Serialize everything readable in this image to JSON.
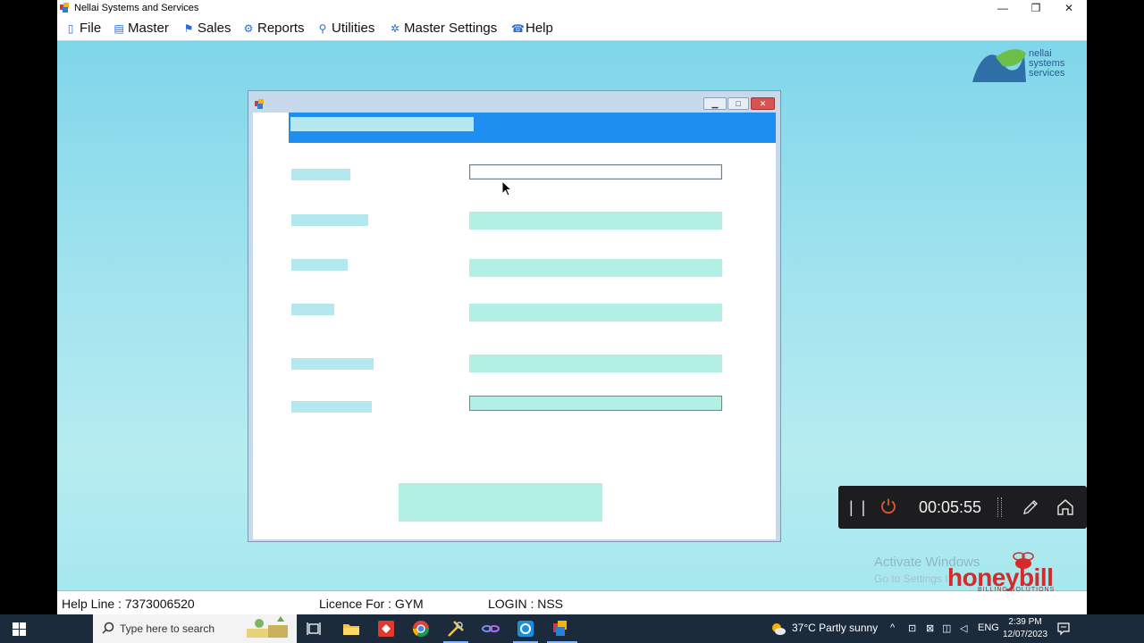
{
  "window": {
    "title": "Nellai Systems and Services",
    "minimize_glyph": "—",
    "restore_glyph": "❐",
    "close_glyph": "✕"
  },
  "menu": {
    "items": [
      {
        "label": "File",
        "icon": "file-icon"
      },
      {
        "label": "Master",
        "icon": "master-icon"
      },
      {
        "label": "Sales",
        "icon": "sales-icon"
      },
      {
        "label": "Reports",
        "icon": "reports-icon"
      },
      {
        "label": "Utilities",
        "icon": "utilities-icon"
      },
      {
        "label": "Master Settings",
        "icon": "settings-icon"
      },
      {
        "label": "Help",
        "icon": "help-icon"
      }
    ]
  },
  "logo": {
    "line1": "nellai",
    "line2": "systems",
    "line3": "services"
  },
  "dialog": {
    "minimize_glyph": "▁",
    "maximize_glyph": "□",
    "close_glyph": "✕"
  },
  "recorder": {
    "elapsed": "00:05:55"
  },
  "watermark": {
    "activate_title": "Activate Windows",
    "activate_sub": "Go to Settings t"
  },
  "brand": {
    "name": "honeybill",
    "tagline": "BILLING SOLUTIONS"
  },
  "status": {
    "helpline": "Help Line : 7373006520",
    "licence": "Licence For :  GYM",
    "login": "LOGIN : NSS"
  },
  "taskbar": {
    "search_placeholder": "Type here to search",
    "weather": "37°C  Partly sunny",
    "language": "ENG",
    "time": "2:39 PM",
    "date": "12/07/2023"
  },
  "colors": {
    "desktop": "#8fdcea",
    "accent_bar": "#1e8ff0",
    "placeholder_block": "#b2f0e6",
    "brand_red": "#d42a2a"
  }
}
